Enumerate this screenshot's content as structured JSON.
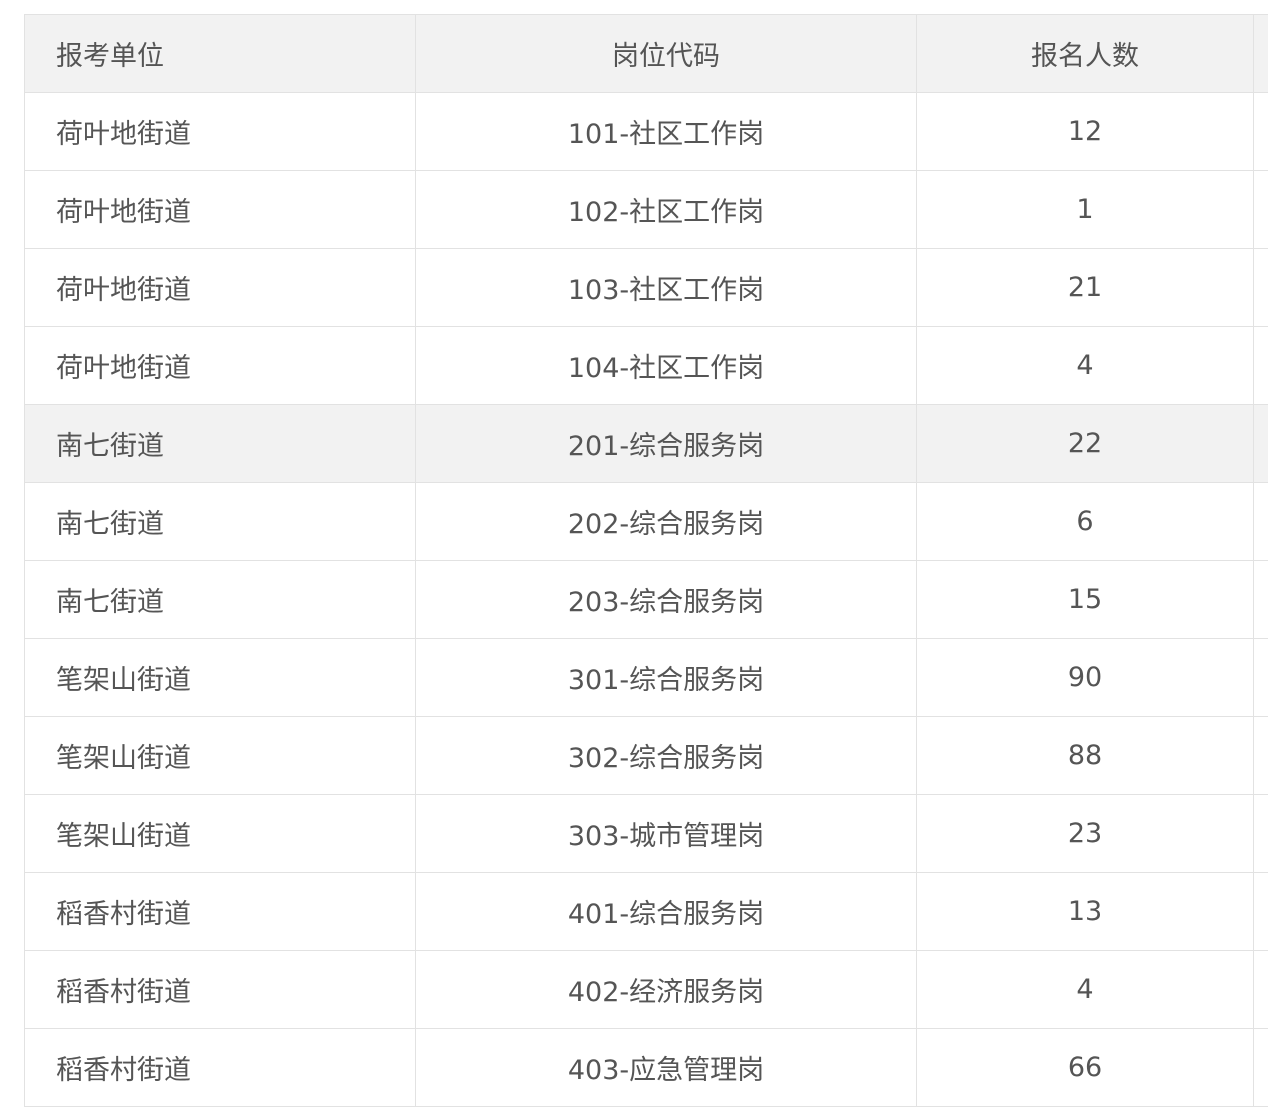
{
  "table": {
    "headers": [
      "报考单位",
      "岗位代码",
      "报名人数",
      ""
    ],
    "rows": [
      {
        "unit": "荷叶地街道",
        "code": "101-社区工作岗",
        "count": "12"
      },
      {
        "unit": "荷叶地街道",
        "code": "102-社区工作岗",
        "count": "1"
      },
      {
        "unit": "荷叶地街道",
        "code": "103-社区工作岗",
        "count": "21"
      },
      {
        "unit": "荷叶地街道",
        "code": "104-社区工作岗",
        "count": "4"
      },
      {
        "unit": "南七街道",
        "code": "201-综合服务岗",
        "count": "22"
      },
      {
        "unit": "南七街道",
        "code": "202-综合服务岗",
        "count": "6"
      },
      {
        "unit": "南七街道",
        "code": "203-综合服务岗",
        "count": "15"
      },
      {
        "unit": "笔架山街道",
        "code": "301-综合服务岗",
        "count": "90"
      },
      {
        "unit": "笔架山街道",
        "code": "302-综合服务岗",
        "count": "88"
      },
      {
        "unit": "笔架山街道",
        "code": "303-城市管理岗",
        "count": "23"
      },
      {
        "unit": "稻香村街道",
        "code": "401-综合服务岗",
        "count": "13"
      },
      {
        "unit": "稻香村街道",
        "code": "402-经济服务岗",
        "count": "4"
      },
      {
        "unit": "稻香村街道",
        "code": "403-应急管理岗",
        "count": "66"
      }
    ],
    "highlighted_row_index": 4,
    "colors": {
      "header_bg": "#f2f2f2",
      "highlight_bg": "#f2f2f2",
      "border": "#e2e2e2",
      "text": "#555555"
    }
  }
}
